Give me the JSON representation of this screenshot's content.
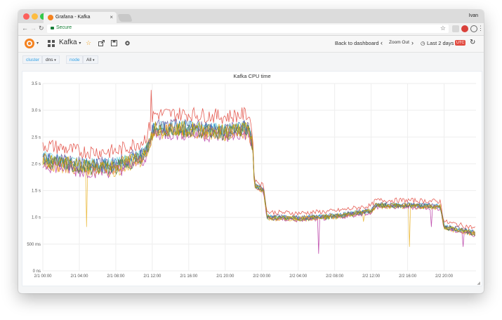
{
  "browser": {
    "tab_title": "Grafana - Kafka",
    "tab_close": "×",
    "user_name": "Ivan",
    "secure_label": "Secure"
  },
  "toolbar": {
    "dashboard_title": "Kafka",
    "title_caret": "▾",
    "back_label": "Back to dashboard",
    "zoom_out_label": "Zoom Out",
    "time_range_label": "Last 2 days",
    "timezone_label": "UTC"
  },
  "variables": [
    {
      "label": "cluster",
      "value": "dns"
    },
    {
      "label": "node",
      "value": "All"
    }
  ],
  "colors": {
    "accent": "#33a2e5",
    "secure": "#188038",
    "utc_badge": "#e24d42",
    "grafana_orange": "#f5821f"
  },
  "chart_data": {
    "type": "line",
    "title": "Kafka CPU time",
    "y_ticks": [
      "0 ns",
      "500 ms",
      "1.0 s",
      "1.5 s",
      "2.0 s",
      "2.5 s",
      "3.0 s",
      "3.5 s"
    ],
    "ylim": [
      0,
      3.5
    ],
    "x_ticks": [
      "2/1 00:00",
      "2/1 04:00",
      "2/1 08:00",
      "2/1 12:00",
      "2/1 16:00",
      "2/1 20:00",
      "2/2 00:00",
      "2/2 04:00",
      "2/2 08:00",
      "2/2 12:00",
      "2/2 16:00",
      "2/2 20:00"
    ],
    "xlim_hours": [
      0,
      47.5
    ],
    "grid": true,
    "legend": "none",
    "baseline": {
      "hours": [
        0,
        4,
        8,
        11,
        11.5,
        12.2,
        16,
        20,
        22.5,
        23,
        23.2,
        24.2,
        24.6,
        28,
        32,
        36,
        36.5,
        40,
        43.6,
        44,
        47.5
      ],
      "values": [
        2.08,
        1.95,
        1.95,
        2.15,
        2.3,
        2.65,
        2.65,
        2.6,
        2.65,
        2.4,
        1.6,
        1.5,
        1.0,
        0.98,
        1.02,
        1.12,
        1.22,
        1.22,
        1.2,
        0.82,
        0.7
      ]
    },
    "series": [
      {
        "color": "#7eb26d",
        "offset": 0.0
      },
      {
        "color": "#eab839",
        "offset": -0.05
      },
      {
        "color": "#6ed0e0",
        "offset": 0.03
      },
      {
        "color": "#ef843c",
        "offset": -0.03
      },
      {
        "color": "#e24d42",
        "offset": 0.28
      },
      {
        "color": "#1f78c1",
        "offset": 0.02
      },
      {
        "color": "#ba43a9",
        "offset": -0.08
      },
      {
        "color": "#705da0",
        "offset": 0.05
      },
      {
        "color": "#508642",
        "offset": -0.02
      },
      {
        "color": "#cca300",
        "offset": 0.01
      }
    ],
    "spikes": [
      {
        "series": 1,
        "hour": 4.8,
        "value": 0.82
      },
      {
        "series": 4,
        "hour": 11.9,
        "value": 3.38
      },
      {
        "series": 6,
        "hour": 30.2,
        "value": 0.32
      },
      {
        "series": 1,
        "hour": 40.2,
        "value": 0.45
      },
      {
        "series": 6,
        "hour": 46.1,
        "value": 0.45
      },
      {
        "series": 6,
        "hour": 42.6,
        "value": 0.82
      },
      {
        "series": 1,
        "hour": 35.2,
        "value": 0.92
      }
    ]
  }
}
